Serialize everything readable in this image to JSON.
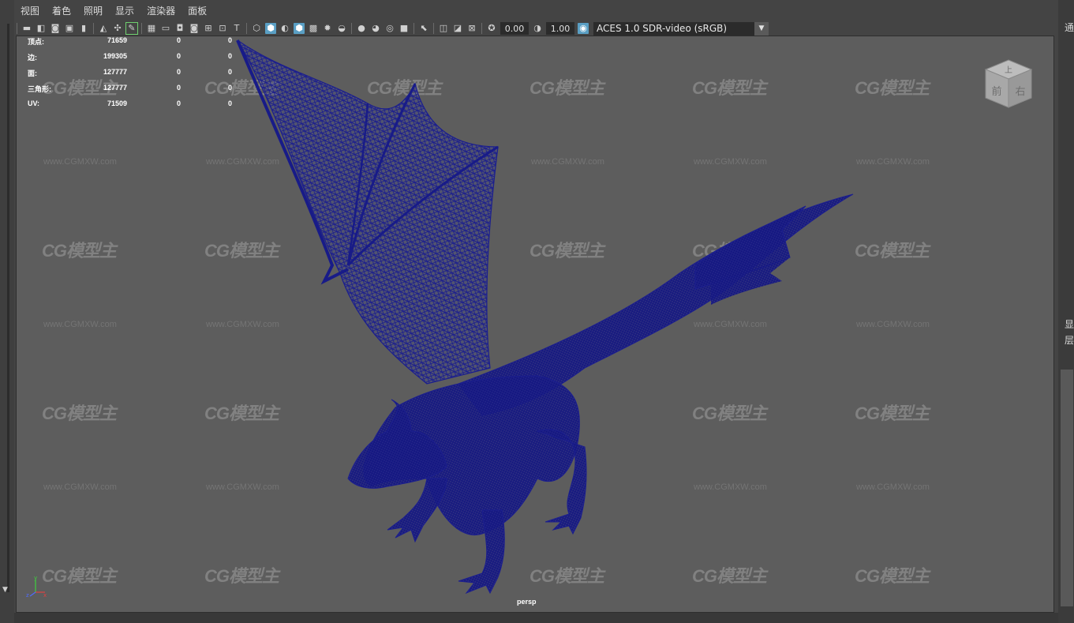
{
  "menu": [
    "视图",
    "着色",
    "照明",
    "显示",
    "渲染器",
    "面板"
  ],
  "toolbar": {
    "exposure": "0.00",
    "gamma": "1.00",
    "colorspace": "ACES 1.0 SDR-video (sRGB)"
  },
  "hud": {
    "rows": [
      {
        "label": "顶点:",
        "v1": "71659",
        "v2": "0",
        "v3": "0"
      },
      {
        "label": "边:",
        "v1": "199305",
        "v2": "0",
        "v3": "0"
      },
      {
        "label": "面:",
        "v1": "127777",
        "v2": "0",
        "v3": "0"
      },
      {
        "label": "三角形:",
        "v1": "127777",
        "v2": "0",
        "v3": "0"
      },
      {
        "label": "UV:",
        "v1": "71509",
        "v2": "0",
        "v3": "0"
      }
    ]
  },
  "viewport": {
    "camera_label": "persp",
    "viewcube": {
      "top": "上",
      "front": "前",
      "right": "右"
    },
    "axis": {
      "x": "x",
      "y": "y",
      "z": "z"
    }
  },
  "watermark": {
    "logo_text": "CG模型主",
    "url_text": "www.CGMXW.com"
  },
  "right_panel": {
    "text_top": "通",
    "text_mid1": "显",
    "text_mid2": "层"
  },
  "colors": {
    "viewport_bg": "#5d5d5d",
    "wireframe": "#1b1e8e",
    "toolbar_active": "#5a9fc4"
  }
}
